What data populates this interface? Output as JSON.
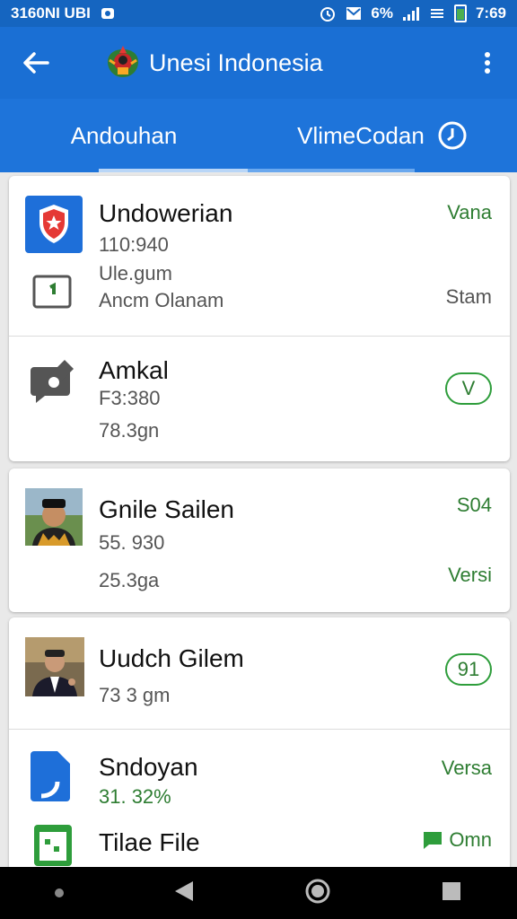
{
  "status": {
    "left_text": "3160NI UBI",
    "pct": "6%",
    "time": "7:69"
  },
  "toolbar": {
    "title": "Unesi Indonesia"
  },
  "tabs": [
    {
      "label": "Andouhan"
    },
    {
      "label": "VlimeCodan"
    }
  ],
  "items": [
    {
      "title": "Undowerian",
      "line1": "110:940",
      "line2": "Ule.gum",
      "line3": "Ancm Olanam",
      "right_top": "Vana",
      "right_bottom": "Stam"
    },
    {
      "title": "Amkal",
      "line1": "F3:380",
      "line2": "78.3gn",
      "pill": "V"
    },
    {
      "title": "Gnile Sailen",
      "line1": "55. 930",
      "line2": "25.3ga",
      "right_top": "S04",
      "right_bottom": "Versi"
    },
    {
      "title": "Uudch Gilem",
      "line1": "73 3 gm",
      "pill": "91"
    },
    {
      "title": "Sndoyan",
      "line1": "31. 32%",
      "right_top": "Versa"
    },
    {
      "title": "Tilae File",
      "right_top": "Omn"
    }
  ],
  "colors": {
    "primary": "#1a6fd4",
    "accent_green": "#2e7d32"
  }
}
